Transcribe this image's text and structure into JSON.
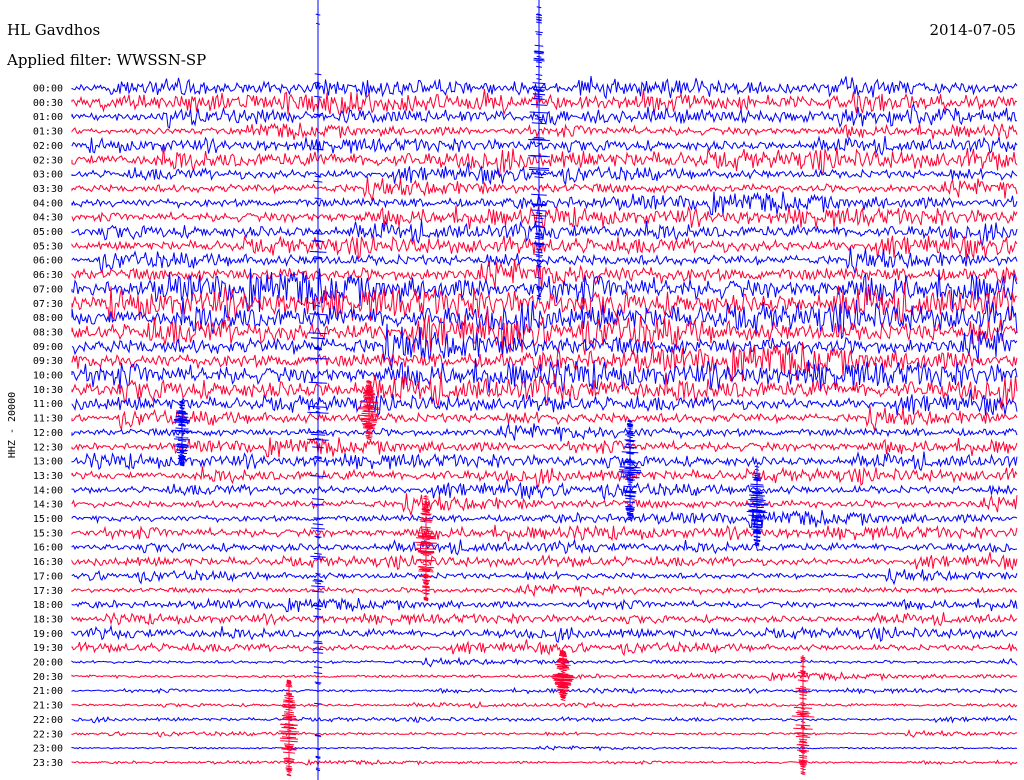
{
  "header": {
    "station": "HL Gavdhos",
    "date": "2014-07-05",
    "filter": "Applied filter: WWSSN-SP"
  },
  "chart_data": {
    "type": "line",
    "title": "HL Gavdhos",
    "ylabel": "HHZ - 20000",
    "colors": [
      "#0000ff",
      "#ff0033"
    ],
    "tick_labels": [
      "00:00",
      "00:30",
      "01:00",
      "01:30",
      "02:00",
      "02:30",
      "03:00",
      "03:30",
      "04:00",
      "04:30",
      "05:00",
      "05:30",
      "06:00",
      "06:30",
      "07:00",
      "07:30",
      "08:00",
      "08:30",
      "09:00",
      "09:30",
      "10:00",
      "10:30",
      "11:00",
      "11:30",
      "12:00",
      "12:30",
      "13:00",
      "13:30",
      "14:00",
      "14:30",
      "15:00",
      "15:30",
      "16:00",
      "16:30",
      "17:00",
      "17:30",
      "18:00",
      "18:30",
      "19:00",
      "19:30",
      "20:00",
      "20:30",
      "21:00",
      "21:30",
      "22:00",
      "22:30",
      "23:00",
      "23:30"
    ],
    "trace_noise_level": [
      0.55,
      0.65,
      0.55,
      0.45,
      0.5,
      0.75,
      0.5,
      0.55,
      0.6,
      0.65,
      0.6,
      0.65,
      0.6,
      0.85,
      1.1,
      1.1,
      1.1,
      1.1,
      1.05,
      1.0,
      0.95,
      0.9,
      0.6,
      0.55,
      0.5,
      0.5,
      0.5,
      0.5,
      0.45,
      0.5,
      0.45,
      0.45,
      0.4,
      0.4,
      0.35,
      0.35,
      0.35,
      0.35,
      0.4,
      0.35,
      0.2,
      0.2,
      0.15,
      0.15,
      0.15,
      0.15,
      0.12,
      0.12
    ]
  }
}
